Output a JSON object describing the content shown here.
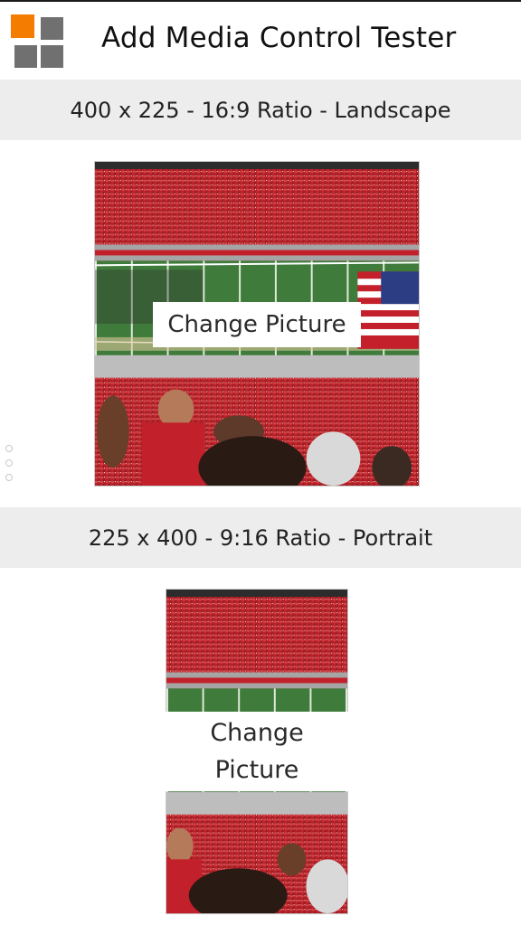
{
  "app": {
    "title": "Add Media Control Tester",
    "logo_icon": "tiles-logo-icon",
    "logo_colors": {
      "accent": "#f47c00",
      "tiles": "#707070"
    }
  },
  "sections": [
    {
      "heading": "400 x 225 - 16:9 Ratio - Landscape",
      "button_label": "Change Picture",
      "image_subject": "stadium-crowd-photo"
    },
    {
      "heading": "225 x 400 - 9:16 Ratio - Portrait",
      "button_label": "Change Picture",
      "image_subject": "stadium-crowd-photo"
    }
  ],
  "page_indicator": {
    "count": 3,
    "icon": "page-dots-icon"
  },
  "colors": {
    "section_bar": "#ededed",
    "field_green": "#3e7a3a",
    "crowd_red": "#c8262b"
  }
}
